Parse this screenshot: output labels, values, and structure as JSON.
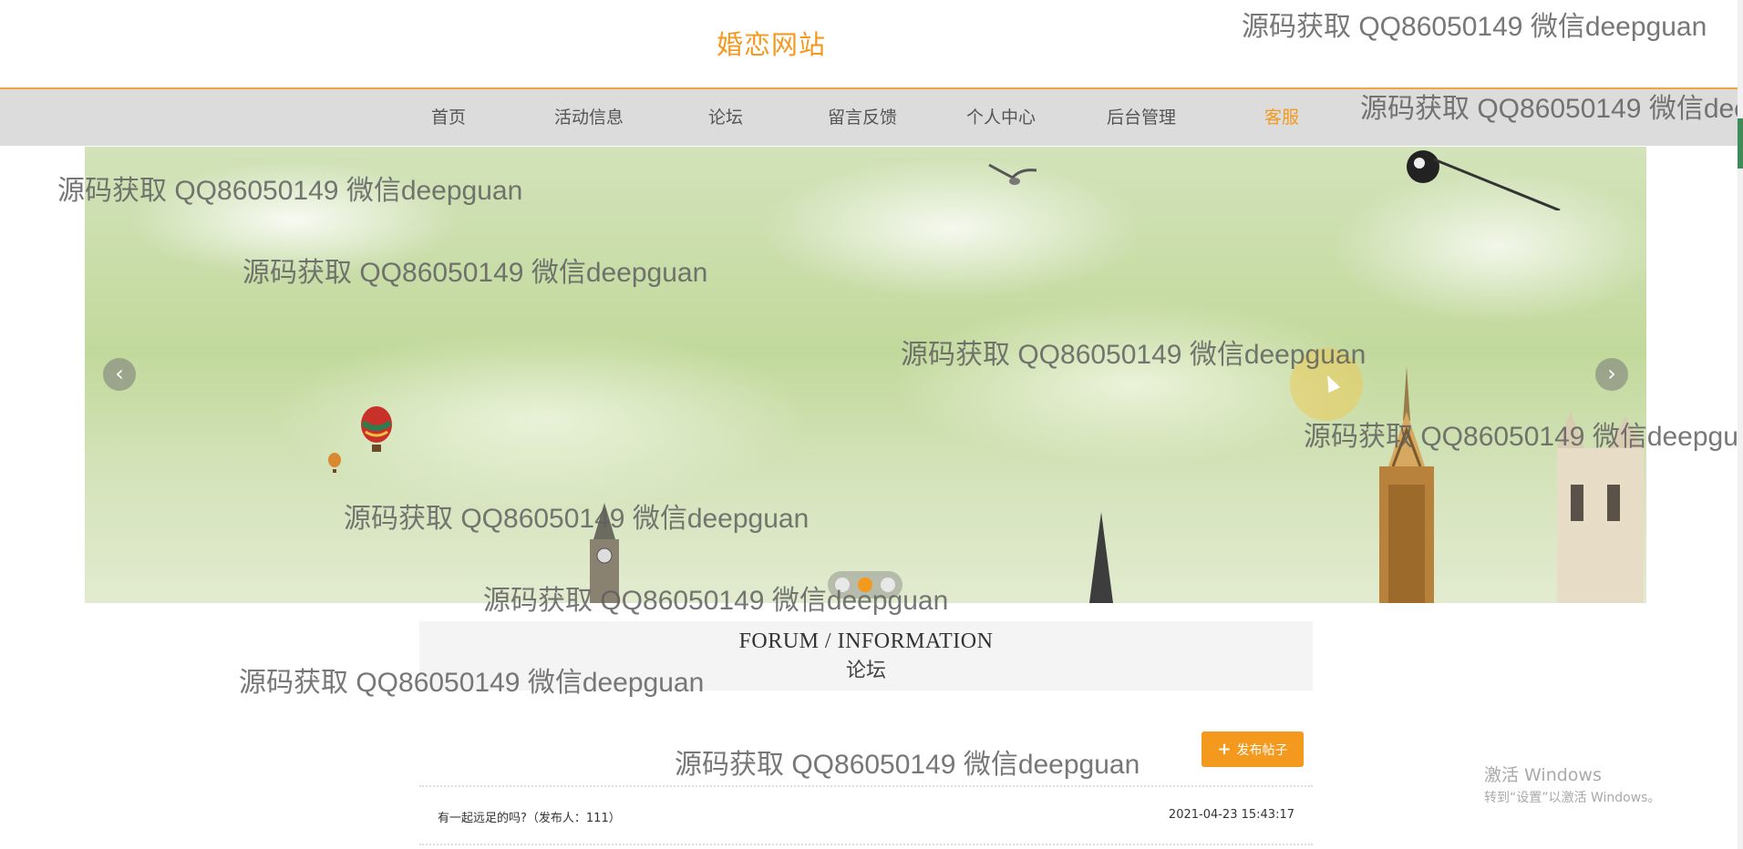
{
  "header": {
    "site_title": "婚恋网站"
  },
  "nav": {
    "items": [
      {
        "label": "首页"
      },
      {
        "label": "活动信息"
      },
      {
        "label": "论坛"
      },
      {
        "label": "留言反馈"
      },
      {
        "label": "个人中心"
      },
      {
        "label": "后台管理"
      },
      {
        "label": "客服"
      }
    ],
    "active_color": "#f39a1e"
  },
  "banner": {
    "prev_glyph": "‹",
    "next_glyph": "›",
    "slide_count": 3,
    "active_slide": 2
  },
  "section": {
    "title_en": "FORUM / INFORMATION",
    "title_cn": "论坛"
  },
  "actions": {
    "post_button": "发布帖子",
    "post_icon": "plus-icon"
  },
  "posts": [
    {
      "title": "有一起远足的吗?（发布人：111）",
      "time": "2021-04-23 15:43:17"
    }
  ],
  "watermark": {
    "text": "源码获取 QQ86050149 微信deepguan"
  },
  "windows_activation": {
    "line1": "激活 Windows",
    "line2": "转到“设置”以激活 Windows。"
  },
  "colors": {
    "accent": "#f39a1e",
    "nav_bg": "#dcdcdc",
    "section_bg": "#f4f4f4"
  }
}
